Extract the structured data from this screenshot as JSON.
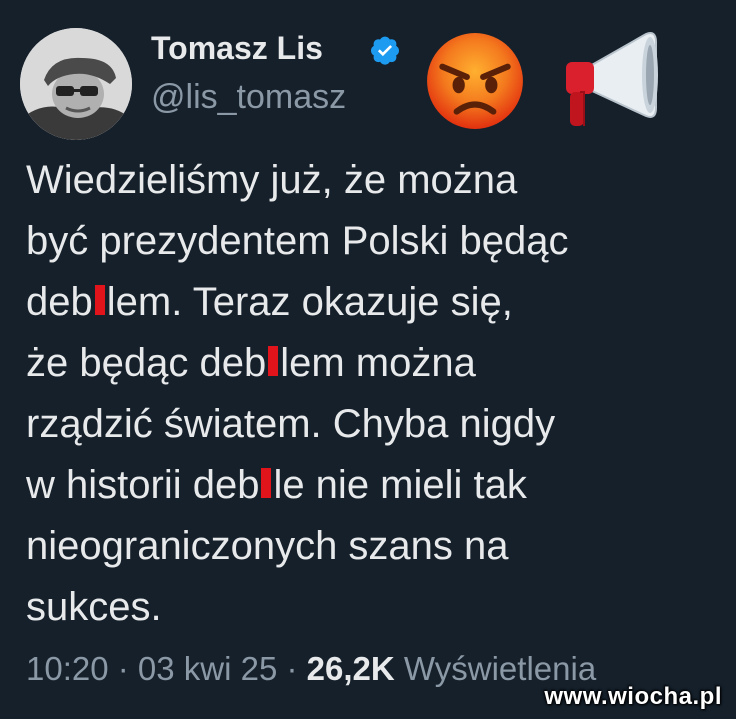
{
  "author": {
    "display_name": "Tomasz Lis",
    "handle": "@lis_tomasz",
    "verified": true
  },
  "emojis": [
    "angry-face-icon",
    "megaphone-icon"
  ],
  "tweet": {
    "lines": [
      {
        "parts": [
          "Wiedzieliśmy już, że można"
        ]
      },
      {
        "parts": [
          "być prezydentem Polski będąc"
        ]
      },
      {
        "parts": [
          "deb",
          "lem. Teraz okazuje się,"
        ]
      },
      {
        "parts": [
          "że będąc deb",
          "lem można"
        ]
      },
      {
        "parts": [
          "rządzić światem. Chyba nigdy"
        ]
      },
      {
        "parts": [
          "w historii deb",
          "le nie mieli tak"
        ]
      },
      {
        "parts": [
          "nieograniczonych szans na"
        ]
      },
      {
        "parts": [
          "sukces."
        ]
      }
    ]
  },
  "meta": {
    "time": "10:20",
    "separator1": " · ",
    "date": "03 kwi 25",
    "separator2": " · ",
    "views_count": "26,2K",
    "views_label": " Wyświetlenia"
  },
  "watermark": "www.wiocha.pl",
  "colors": {
    "background": "#15202b",
    "text": "#e7e9ea",
    "secondary": "#8b98a5",
    "verified": "#1d9bf0",
    "censor_bar": "#e0141a"
  }
}
